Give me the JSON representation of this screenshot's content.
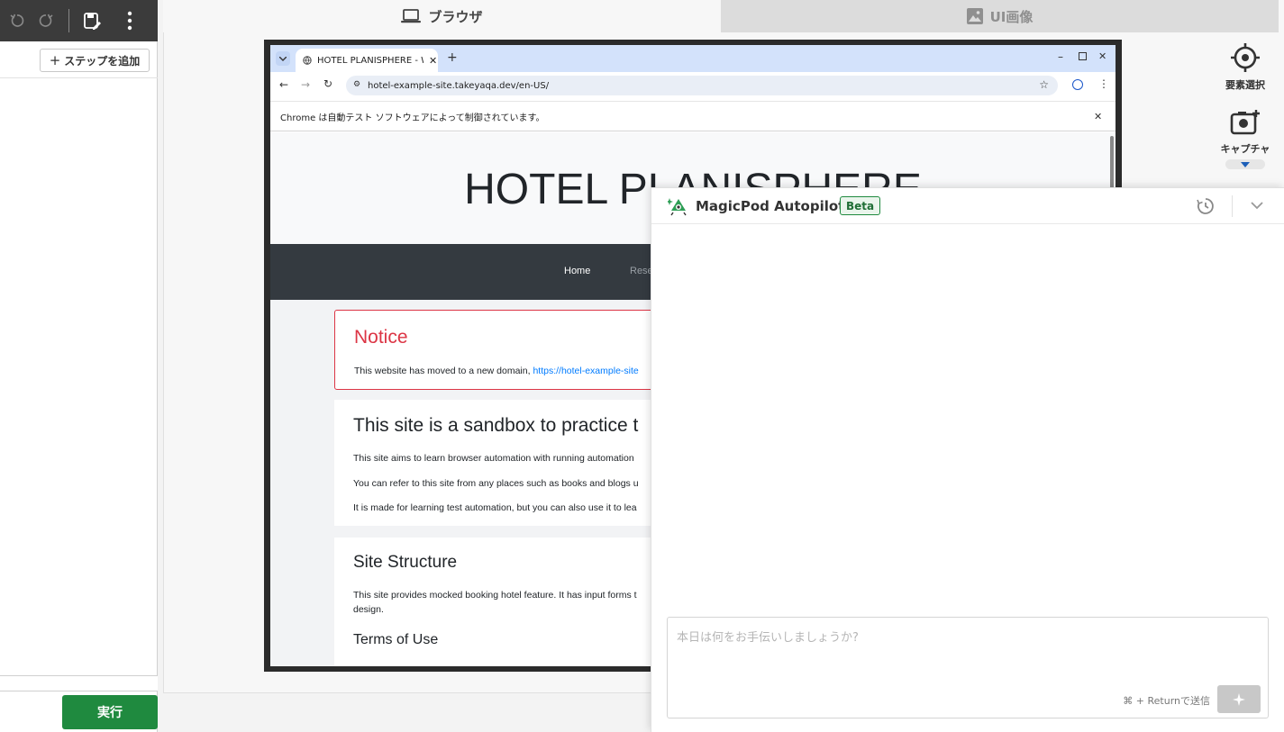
{
  "left_panel": {
    "add_step_label": "ステップを追加",
    "run_label": "実行"
  },
  "tabs": {
    "browser_label": "ブラウザ",
    "ui_image_label": "UI画像"
  },
  "side_tools": {
    "element_select_label": "要素選択",
    "capture_label": "キャプチャ"
  },
  "chrome": {
    "tab_title": "HOTEL PLANISPHERE - We",
    "url": "hotel-example-site.takeyaqa.dev/en-US/",
    "automation_notice": "Chrome は自動テスト ソフトウェアによって制御されています。"
  },
  "site": {
    "title": "HOTEL PLANISPHERE",
    "nav": [
      "Home",
      "Rese"
    ],
    "notice_title": "Notice",
    "notice_text": "This website has moved to a new domain, ",
    "notice_link": "https://hotel-example-site",
    "sandbox_title": "This site is a sandbox to practice t",
    "sandbox_p1": "This site aims to learn browser automation with running automation",
    "sandbox_p2": "You can refer to this site from any places such as books and blogs u",
    "sandbox_p3": "It is made for learning test automation, but you can also use it to lea",
    "structure_title": "Site Structure",
    "structure_p1": "This site provides mocked booking hotel feature. It has input forms t",
    "structure_p2": "design.",
    "terms_title": "Terms of Use"
  },
  "autopilot": {
    "title": "MagicPod Autopilot",
    "badge": "Beta",
    "input_placeholder": "本日は何をお手伝いしましょうか?",
    "send_hint": "⌘ + Returnで送信"
  },
  "colors": {
    "run_button": "#1f8a3f",
    "notice_red": "#dc3545",
    "link_blue": "#007bff",
    "nav_dark": "#343a40"
  }
}
